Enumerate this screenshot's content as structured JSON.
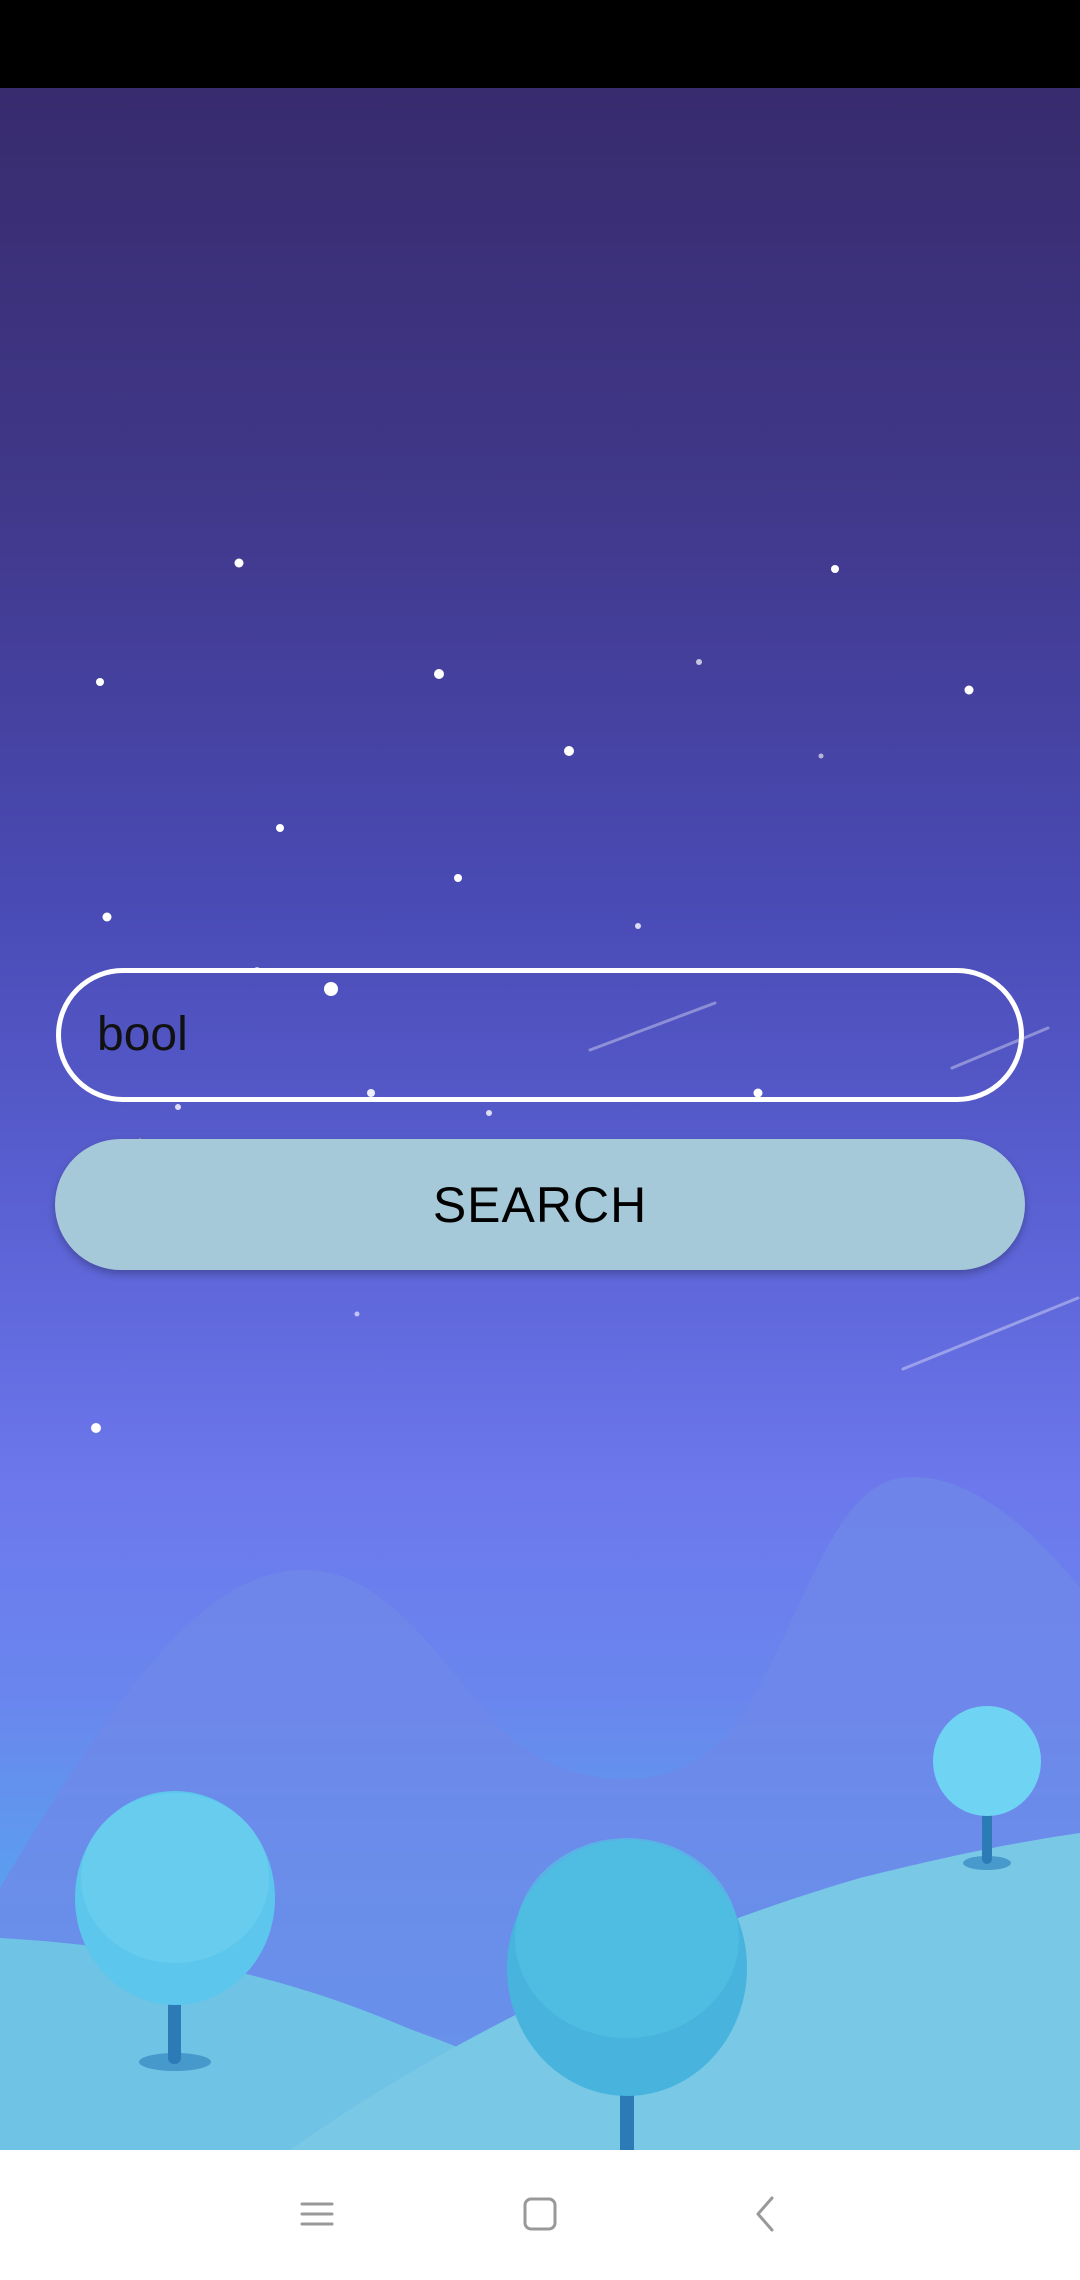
{
  "search": {
    "value": "bool",
    "button_label": "SEARCH"
  },
  "nav": {
    "recents_icon": "menu-icon",
    "home_icon": "square-icon",
    "back_icon": "chevron-left-icon"
  },
  "colors": {
    "button_bg": "#a6c9d9",
    "input_border": "#ffffff",
    "nav_bg": "#ffffff"
  }
}
